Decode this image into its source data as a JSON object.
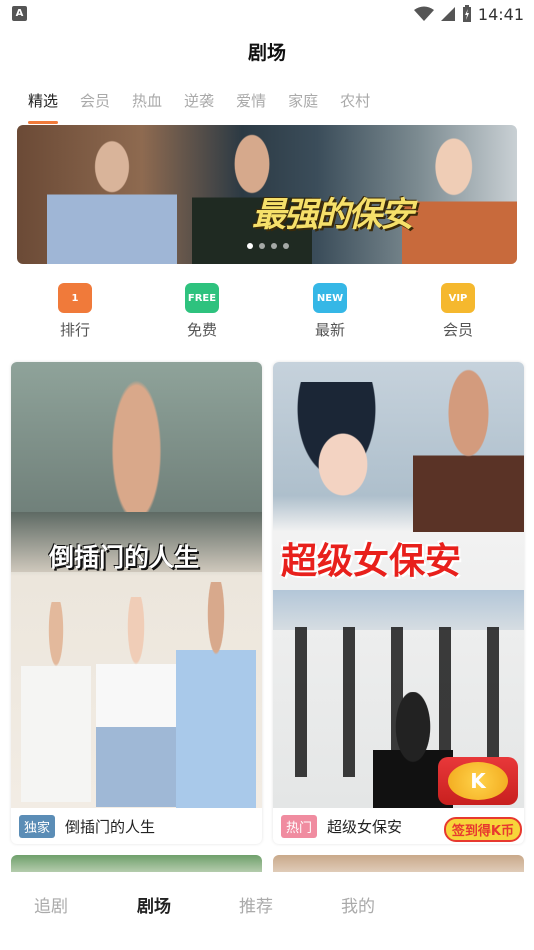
{
  "status_bar": {
    "time": "14:41",
    "notification_letter": "A"
  },
  "header": {
    "title": "剧场"
  },
  "tabs": [
    {
      "label": "精选",
      "active": true
    },
    {
      "label": "会员"
    },
    {
      "label": "热血"
    },
    {
      "label": "逆袭"
    },
    {
      "label": "爱情"
    },
    {
      "label": "家庭"
    },
    {
      "label": "农村"
    }
  ],
  "banner": {
    "title_art": "最强的保安",
    "page_count": 4,
    "current_page": 1
  },
  "quick_links": [
    {
      "label": "排行",
      "icon": "ranking-icon",
      "icon_text": "1",
      "color": "#f07a3a"
    },
    {
      "label": "免费",
      "icon": "free-icon",
      "icon_text": "FREE",
      "color": "#2ec27e"
    },
    {
      "label": "最新",
      "icon": "new-icon",
      "icon_text": "NEW",
      "color": "#35b7e6"
    },
    {
      "label": "会员",
      "icon": "vip-icon",
      "icon_text": "VIP",
      "color": "#f5b82e"
    }
  ],
  "cards": [
    {
      "title": "倒插门的人生",
      "badge": "独家",
      "badge_color": "#5b8db6",
      "poster_text": "倒插门的人生"
    },
    {
      "title": "超级女保安",
      "badge": "热门",
      "badge_color": "#f08ca0",
      "poster_text": "超级女保安",
      "promo": "签到得K币"
    }
  ],
  "bottom_nav": [
    {
      "label": "追剧"
    },
    {
      "label": "剧场",
      "active": true
    },
    {
      "label": "推荐"
    },
    {
      "label": "我的"
    }
  ]
}
